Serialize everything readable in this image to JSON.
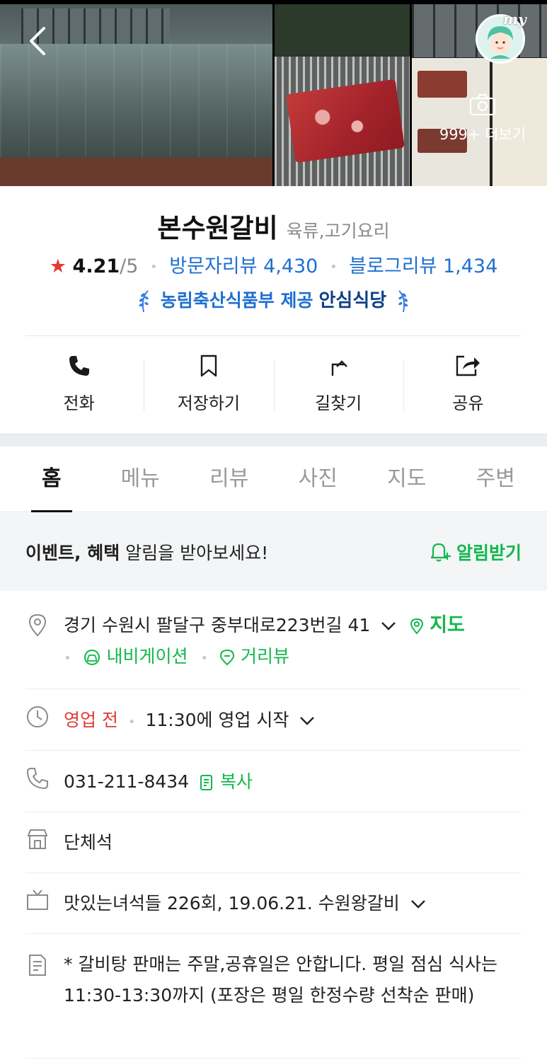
{
  "header": {
    "more_photos_label": "999+ 더보기",
    "my_label": "my"
  },
  "place": {
    "name": "본수원갈비",
    "category": "육류,고기요리",
    "rating": "4.21",
    "rating_max": "/5",
    "visitor_review_label": "방문자리뷰",
    "visitor_review_count": "4,430",
    "blog_review_label": "블로그리뷰",
    "blog_review_count": "1,434",
    "badge_provider": "농림축산식품부 제공",
    "badge_name": "안심식당"
  },
  "actions": [
    {
      "label": "전화",
      "icon": "phone-icon"
    },
    {
      "label": "저장하기",
      "icon": "bookmark-icon"
    },
    {
      "label": "길찾기",
      "icon": "directions-icon"
    },
    {
      "label": "공유",
      "icon": "share-icon"
    }
  ],
  "tabs": [
    {
      "label": "홈",
      "active": true
    },
    {
      "label": "메뉴"
    },
    {
      "label": "리뷰"
    },
    {
      "label": "사진"
    },
    {
      "label": "지도"
    },
    {
      "label": "주변"
    }
  ],
  "event": {
    "bold": "이벤트, 혜택",
    "rest": " 알림을 받아보세요!",
    "button": "알림받기"
  },
  "info": {
    "address": "경기 수원시 팔달구 중부대로223번길 41",
    "map_link": "지도",
    "nav_link": "내비게이션",
    "street_link": "거리뷰",
    "status": "영업 전",
    "open_time": "11:30에 영업 시작",
    "phone": "031-211-8434",
    "copy_label": "복사",
    "facility": "단체석",
    "tv": "맛있는녀석들 226회, 19.06.21. 수원왕갈비",
    "notice": "* 갈비탕 판매는 주말,공휴일은 안합니다. 평일 점심 식사는 11:30-13:30까지 (포장은 평일 한정수량 선착순 판매)"
  },
  "colors": {
    "accent_green": "#12b84b",
    "link_blue": "#1f6fd1",
    "star_red": "#e23b33"
  }
}
